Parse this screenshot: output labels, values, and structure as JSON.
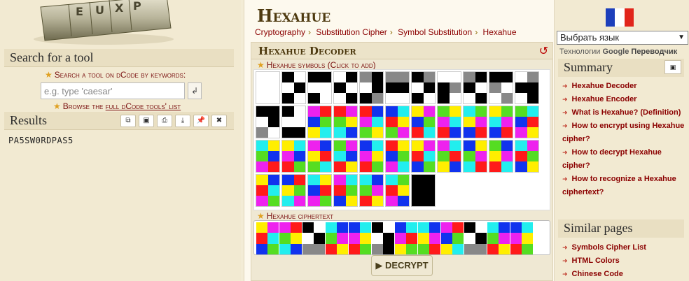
{
  "left": {
    "search_title": "Search for a tool",
    "search_hint": "Search a tool on dCode by keywords:",
    "search_placeholder": "e.g. type 'caesar'",
    "browse_prefix": "Browse the ",
    "browse_link": "full dCode tools' list",
    "results_title": "Results",
    "results_text": "PA5SW0RDPAS5"
  },
  "center": {
    "page_title": "Hexahue",
    "breadcrumb": [
      "Cryptography",
      "Substitution Cipher",
      "Symbol Substitution",
      "Hexahue"
    ],
    "tool_title": "Hexahue Decoder",
    "symbols_label": "Hexahue symbols (Click to add)",
    "ciphertext_label": "Hexahue ciphertext",
    "decrypt_label": "▶ DECRYPT"
  },
  "right": {
    "lang_select": "Выбрать язык",
    "translate_prefix": "Технологии ",
    "translate_google": "Google",
    "translate_suffix": "Переводчик",
    "summary_title": "Summary",
    "summary_items": [
      "Hexahue Decoder",
      "Hexahue Encoder",
      "What is Hexahue? (Definition)",
      "How to encrypt using Hexahue cipher?",
      "How to decrypt Hexahue cipher?",
      "How to recognize a Hexahue ciphertext?"
    ],
    "similar_title": "Similar pages",
    "similar_items": [
      "Symbols Cipher List",
      "HTML Colors",
      "Chinese Code"
    ]
  },
  "colors": {
    "accent": "#8b0000",
    "R": "#ff1a1a",
    "G": "#55dd22",
    "B": "#1133ee",
    "Y": "#ffee00",
    "C": "#22eeee",
    "M": "#ee22ee",
    "K": "#000000",
    "W": "#ffffff",
    "A": "#888888"
  },
  "symbols": [
    "WWWWWW",
    "KWWKKW",
    "KKWWKW",
    "WKKWWK",
    "AKWKKA",
    "AAKKWW",
    "KAWKKW",
    "WWKAKW",
    "AKKWWK",
    "KKAWWA",
    "WAKKWK",
    "KKWKAW",
    "KWWWKK",
    "MRBGYC",
    "RMGYCB",
    "RBMCGY",
    "BCRYGM",
    "YMBGRC",
    "GYMCRB",
    "CGYMBR",
    "YGCMBR",
    "GCBRMY",
    "CYGBMR",
    "YCMBRG",
    "MBYRGC",
    "GMCBRY",
    "BCMYRG",
    "RYBGMC",
    "YMRCBG",
    "MCGRYB",
    "BYGMCR",
    "GBYMRC",
    "CMRGBY",
    "YBRCMG",
    "BRYGCM",
    "CYBRMG",
    "MCRGBY",
    "CBGMRY",
    "CGRYMB",
    "KKKKKK"
  ],
  "ciphertext": [
    "YMRCBG",
    "MRGYCB",
    "KWWKAA",
    "CBGMRY",
    "BCMYRG",
    "KWWKAK",
    "BCMRYG",
    "CBYMGR",
    "MRBGYC",
    "KWWKAA",
    "CBGMRY",
    "BCMYRG"
  ]
}
